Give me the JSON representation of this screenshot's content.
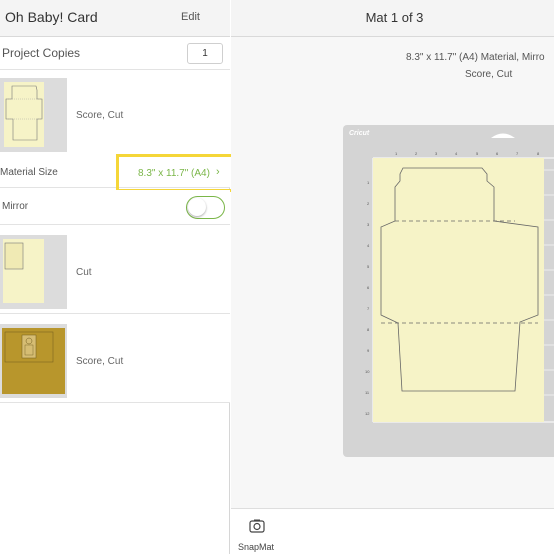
{
  "left_panel": {
    "title": "Oh Baby! Card",
    "edit_label": "Edit",
    "copies": {
      "label": "Project Copies",
      "value": "1"
    },
    "mats": [
      {
        "label": "Score, Cut"
      },
      {
        "label": "Cut"
      },
      {
        "label": "Score, Cut"
      }
    ],
    "material_size": {
      "label": "Material Size",
      "value": "8.3\" x 11.7\" (A4)",
      "chevron": "›"
    },
    "mirror": {
      "label": "Mirror",
      "on": false
    }
  },
  "right_panel": {
    "title": "Mat 1 of 3",
    "info_line1": "8.3\" x 11.7\" (A4) Material, Mirro",
    "info_line2": "Score, Cut",
    "mat_brand": "Cricut",
    "ruler_top": [
      "1",
      "2",
      "3",
      "4",
      "5",
      "6",
      "7",
      "8"
    ],
    "ruler_left": [
      "1",
      "2",
      "3",
      "4",
      "5",
      "6",
      "7",
      "8",
      "9",
      "10",
      "11",
      "12"
    ]
  },
  "bottom_bar": {
    "snapmat_label": "SnapMat",
    "icon": "camera-icon"
  },
  "colors": {
    "accent_green": "#7ab648",
    "highlight_yellow": "#f5d638",
    "paper_cream": "#f6f3c7",
    "gold_paper": "#b8962c"
  }
}
